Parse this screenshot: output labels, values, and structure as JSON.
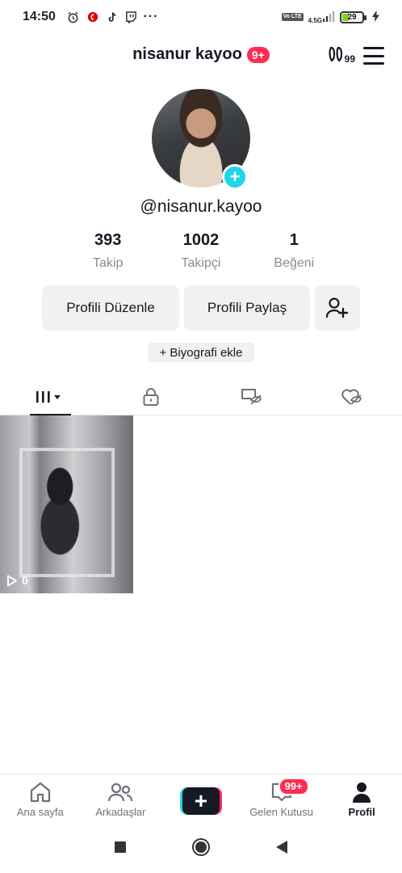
{
  "status_bar": {
    "time": "14:50",
    "volte": "Vo LTE",
    "network": "4.5G",
    "battery": "29",
    "battery_level": 0.29
  },
  "header": {
    "profile_name": "nisanur kayoo",
    "name_badge": "9+",
    "creator_tools_count": "99"
  },
  "profile": {
    "handle": "@nisanur.kayoo",
    "stats": [
      {
        "value": "393",
        "label": "Takip"
      },
      {
        "value": "1002",
        "label": "Takipçi"
      },
      {
        "value": "1",
        "label": "Beğeni"
      }
    ],
    "edit_label": "Profili Düzenle",
    "share_label": "Profili Paylaş",
    "bio_label": "+ Biyografi ekle"
  },
  "tabs": [
    {
      "name": "videos-tab",
      "icon": "grid-icon",
      "active": true
    },
    {
      "name": "private-tab",
      "icon": "lock-icon",
      "active": false
    },
    {
      "name": "reposts-tab",
      "icon": "repost-hidden-icon",
      "active": false
    },
    {
      "name": "liked-tab",
      "icon": "heart-hidden-icon",
      "active": false
    }
  ],
  "videos": [
    {
      "views": "0"
    }
  ],
  "bottom_nav": {
    "home": "Ana sayfa",
    "friends": "Arkadaşlar",
    "create": "+",
    "inbox": "Gelen Kutusu",
    "inbox_badge": "99+",
    "profile": "Profil"
  },
  "colors": {
    "accent": "#fe2c55",
    "cyan": "#20d5ec",
    "text": "#161823",
    "muted": "#8a8b91",
    "button_bg": "#f1f1f2"
  }
}
